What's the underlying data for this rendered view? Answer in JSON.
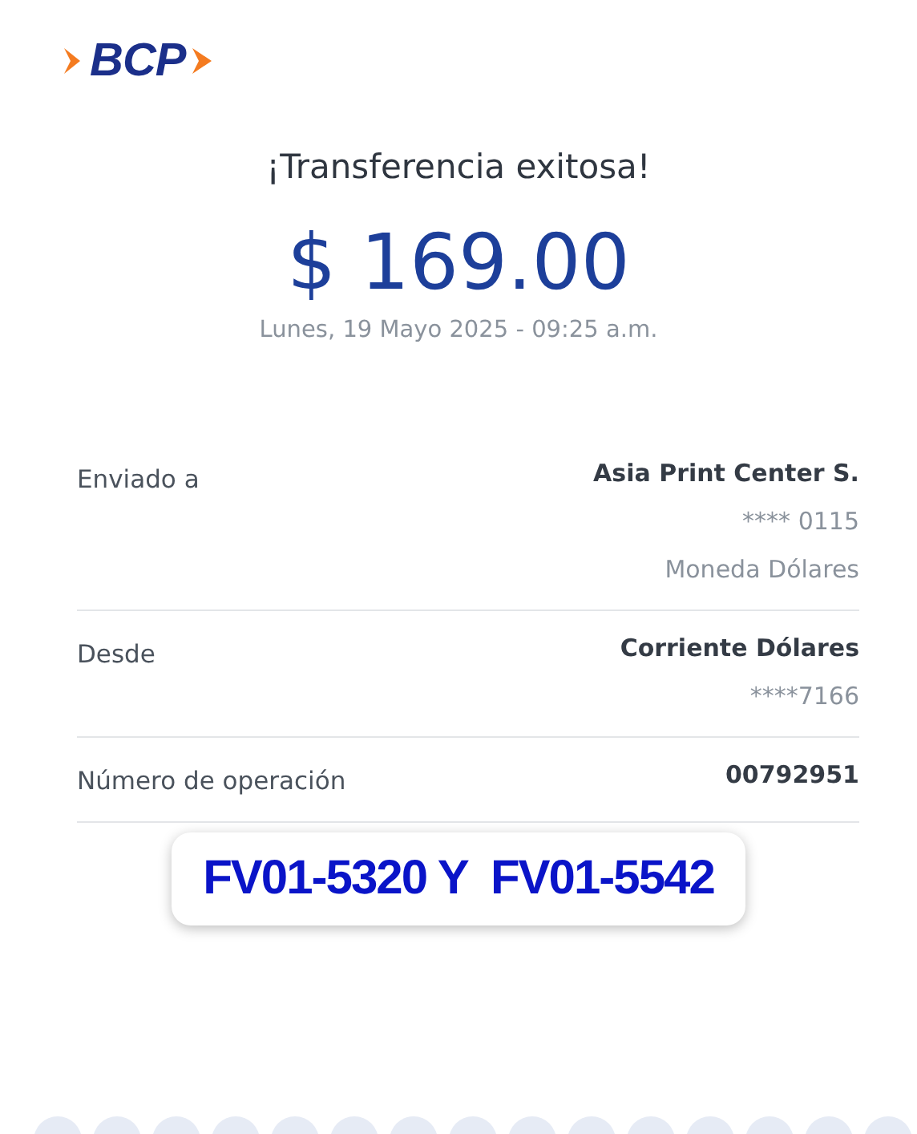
{
  "logo": {
    "text": "BCP"
  },
  "title": "¡Transferencia exitosa!",
  "amount": "$ 169.00",
  "datetime": "Lunes, 19 Mayo 2025 - 09:25 a.m.",
  "details": [
    {
      "label": "Enviado a",
      "values": [
        {
          "text": "Asia Print Center S.",
          "kind": "primary"
        },
        {
          "text": "**** 0115",
          "kind": "secondary"
        },
        {
          "text": "Moneda Dólares",
          "kind": "secondary"
        }
      ]
    },
    {
      "label": "Desde",
      "values": [
        {
          "text": "Corriente Dólares",
          "kind": "primary"
        },
        {
          "text": "****7166",
          "kind": "secondary"
        }
      ]
    },
    {
      "label": "Número de operación",
      "values": [
        {
          "text": "00792951",
          "kind": "primary"
        }
      ]
    }
  ],
  "note": "FV01-5320 Y  FV01-5542"
}
